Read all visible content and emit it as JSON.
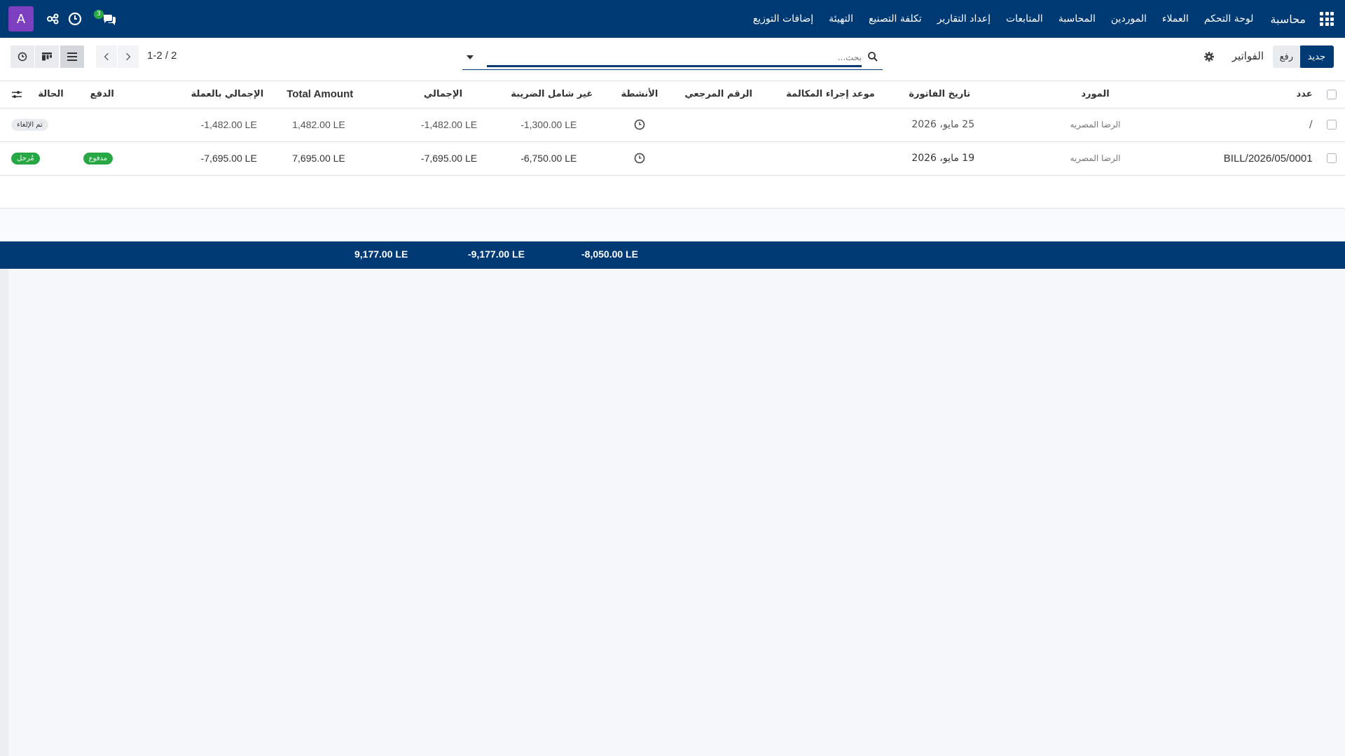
{
  "navbar": {
    "brand": "محاسبة",
    "menu": [
      "لوحة التحكم",
      "العملاء",
      "الموردين",
      "المحاسبة",
      "المتابعات",
      "إعداد التقارير",
      "تكلفة التصنيع",
      "التهيئة",
      "إضافات التوزيع"
    ],
    "avatar_letter": "A",
    "chat_count": "3",
    "color": "#003a75"
  },
  "control": {
    "new_label": "جديد",
    "upload_label": "رفع",
    "title": "الفواتير",
    "search_placeholder": "بحث...",
    "pager": "1-2 / 2"
  },
  "table": {
    "headers": {
      "number": "عدد",
      "vendor": "المورد",
      "invoice_date": "تاريخ الفاتورة",
      "due_date": "موعد إجراء المكالمة",
      "reference": "الرقم المرجعي",
      "activities": "الأنشطة",
      "untaxed": "غير شامل الضريبة",
      "total": "الإجمالي",
      "total_amount": "Total Amount",
      "total_currency": "الإجمالي بالعملة",
      "payment": "الدفع",
      "status": "الحالة"
    },
    "rows": [
      {
        "number": "/",
        "vendor": "الرضا المصريه",
        "invoice_date": "25 مايو، 2026",
        "untaxed": "-1,300.00 LE",
        "total": "-1,482.00 LE",
        "total_amount": "1,482.00 LE",
        "total_currency": "-1,482.00 LE",
        "payment": "",
        "status": "تم الإلغاء"
      },
      {
        "number": "BILL/2026/05/0001",
        "vendor": "الرضا المصريه",
        "invoice_date": "19 مايو، 2026",
        "untaxed": "-6,750.00 LE",
        "total": "-7,695.00 LE",
        "total_amount": "7,695.00 LE",
        "total_currency": "-7,695.00 LE",
        "payment": "مدفوع",
        "status": "مُرحل"
      }
    ],
    "footer": {
      "untaxed": "-8,050.00 LE",
      "total": "-9,177.00 LE",
      "total_amount": "9,177.00 LE"
    }
  }
}
